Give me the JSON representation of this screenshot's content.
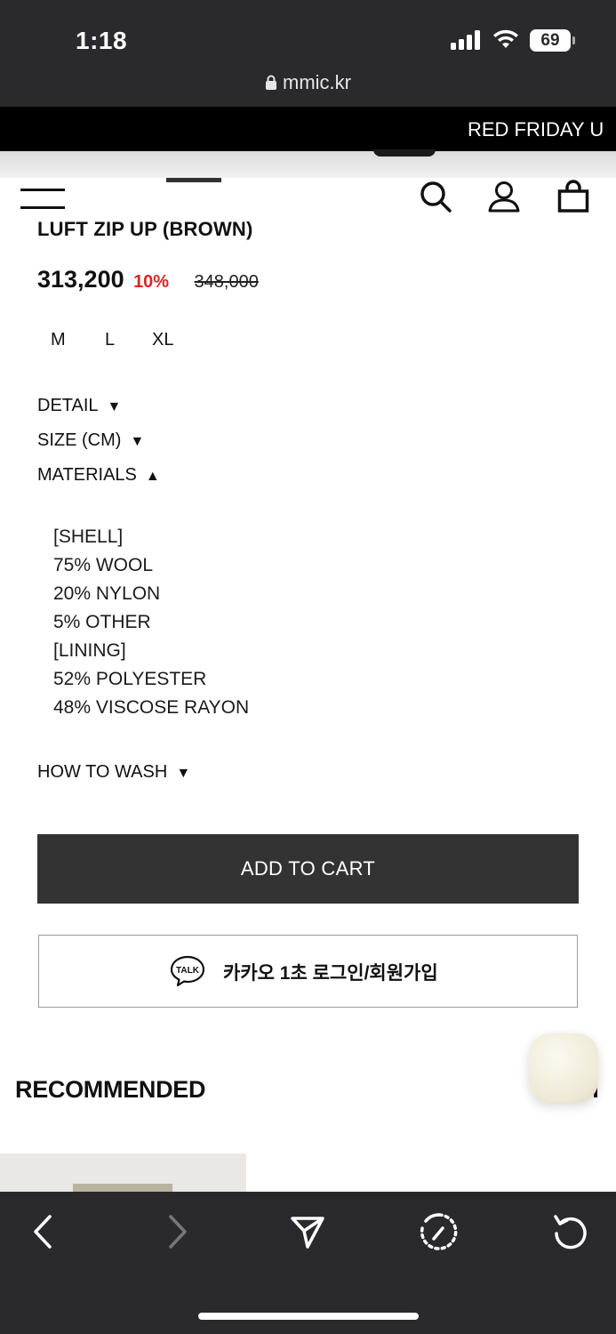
{
  "status_bar": {
    "time": "1:18",
    "battery": "69",
    "icons": [
      "signal-icon",
      "wifi-icon",
      "battery-icon"
    ]
  },
  "browser": {
    "url": "mmic.kr",
    "toolbar_icons": [
      "back-icon",
      "forward-icon",
      "share-icon",
      "speed-dial-icon",
      "reload-icon"
    ]
  },
  "banner": {
    "text": "RED FRIDAY U"
  },
  "header": {
    "icons": [
      "menu-icon",
      "search-icon",
      "account-icon",
      "cart-icon"
    ]
  },
  "product": {
    "title": "LUFT ZIP UP (BROWN)",
    "price": "313,200",
    "discount": "10%",
    "original_price": "348,000",
    "sizes": [
      "M",
      "L",
      "XL"
    ]
  },
  "sections": {
    "detail": {
      "label": "DETAIL",
      "arrow": "▼"
    },
    "size": {
      "label": "SIZE (CM)",
      "arrow": "▼"
    },
    "materials": {
      "label": "MATERIALS",
      "arrow": "▲",
      "lines": [
        "[SHELL]",
        "75% WOOL",
        "20% NYLON",
        "5% OTHER",
        "[LINING]",
        "52% POLYESTER",
        "48% VISCOSE RAYON"
      ]
    },
    "wash": {
      "label": "HOW TO WASH",
      "arrow": "▼"
    }
  },
  "actions": {
    "add_to_cart": "ADD TO CART",
    "kakao_badge": "TALK",
    "kakao_login": "카카오 1초 로그인/회원가입"
  },
  "recommended": {
    "title": "RECOMMENDED"
  },
  "colors": {
    "bar_bg": "#2a2a2c",
    "cart_button": "#333333",
    "discount": "#d82626"
  }
}
